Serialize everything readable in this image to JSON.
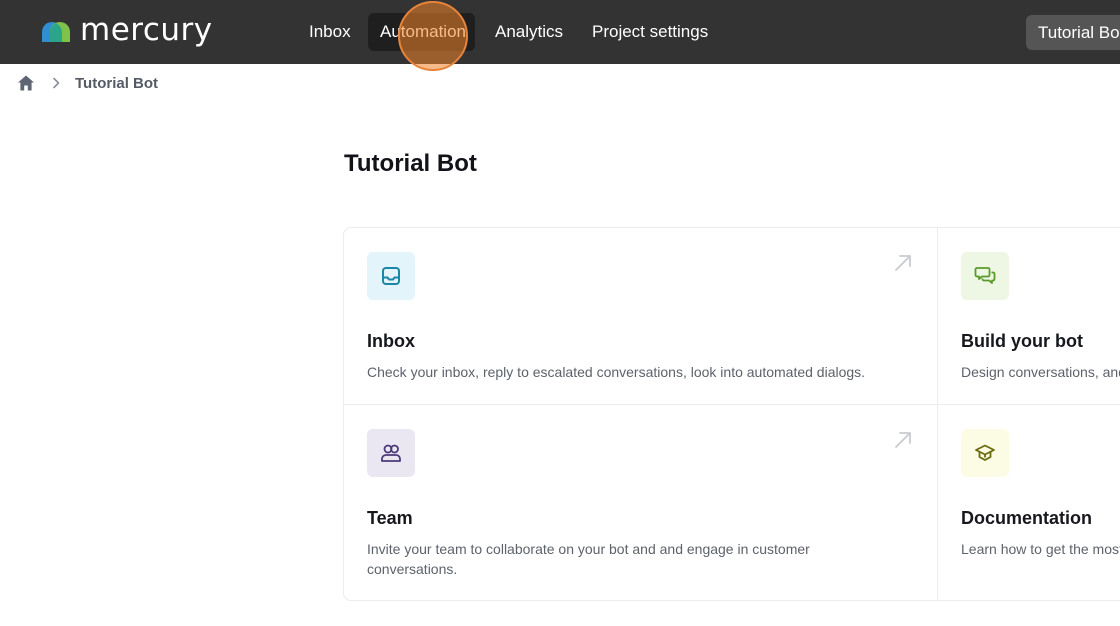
{
  "app": {
    "logo_text": "mercury"
  },
  "nav": {
    "items": [
      {
        "label": "Inbox"
      },
      {
        "label": "Automation",
        "active": true
      },
      {
        "label": "Analytics"
      },
      {
        "label": "Project settings"
      }
    ],
    "bot_selector": "Tutorial Bot"
  },
  "breadcrumb": {
    "home_icon": "home-icon",
    "separator_icon": "chevron-right-icon",
    "current": "Tutorial Bot"
  },
  "page": {
    "title": "Tutorial Bot"
  },
  "cards": [
    {
      "title": "Inbox",
      "description": "Check your inbox, reply to escalated conversations, look into automated dialogs.",
      "icon": "inbox-icon",
      "arrow_icon": "arrow-up-right-icon"
    },
    {
      "title": "Build your bot",
      "description": "Design conversations, and",
      "icon": "chat-bubbles-icon"
    },
    {
      "title": "Team",
      "description": "Invite your team to collaborate on your bot and and engage in customer conversations.",
      "icon": "users-icon",
      "arrow_icon": "arrow-up-right-icon"
    },
    {
      "title": "Documentation",
      "description": "Learn how to get the most",
      "icon": "graduation-cap-icon"
    }
  ],
  "colors": {
    "topbar": "#333333",
    "active_nav": "#1f1f1f",
    "click_marker": "#e8843a",
    "inbox_icon": "#1a86a8",
    "build_icon": "#5a9a2a",
    "team_icon": "#4b3a78",
    "docs_icon": "#6a6a10"
  }
}
